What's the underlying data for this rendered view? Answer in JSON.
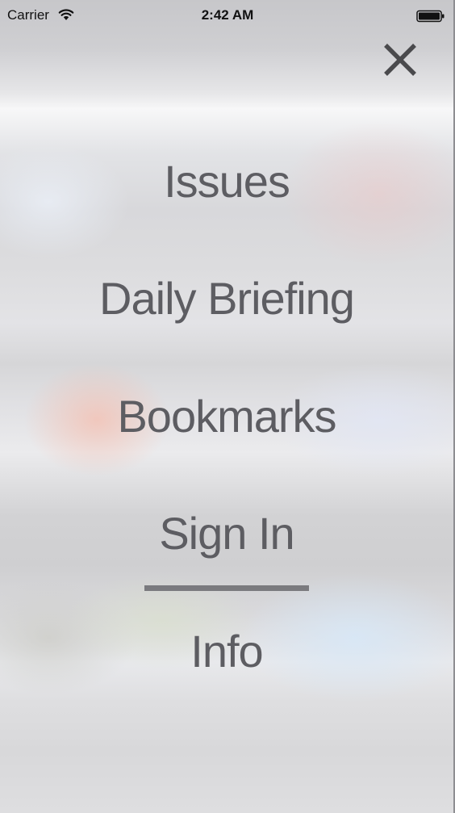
{
  "status_bar": {
    "carrier": "Carrier",
    "time": "2:42 AM",
    "wifi_icon": "wifi-icon",
    "battery_icon": "battery-icon"
  },
  "close_icon": "close-icon",
  "menu": {
    "items": [
      {
        "label": "Issues"
      },
      {
        "label": "Daily Briefing"
      },
      {
        "label": "Bookmarks"
      },
      {
        "label": "Sign In",
        "selected": true
      },
      {
        "label": "Info"
      }
    ]
  },
  "colors": {
    "menu_text": "#5d5d62",
    "underline": "#7a7a7e"
  }
}
